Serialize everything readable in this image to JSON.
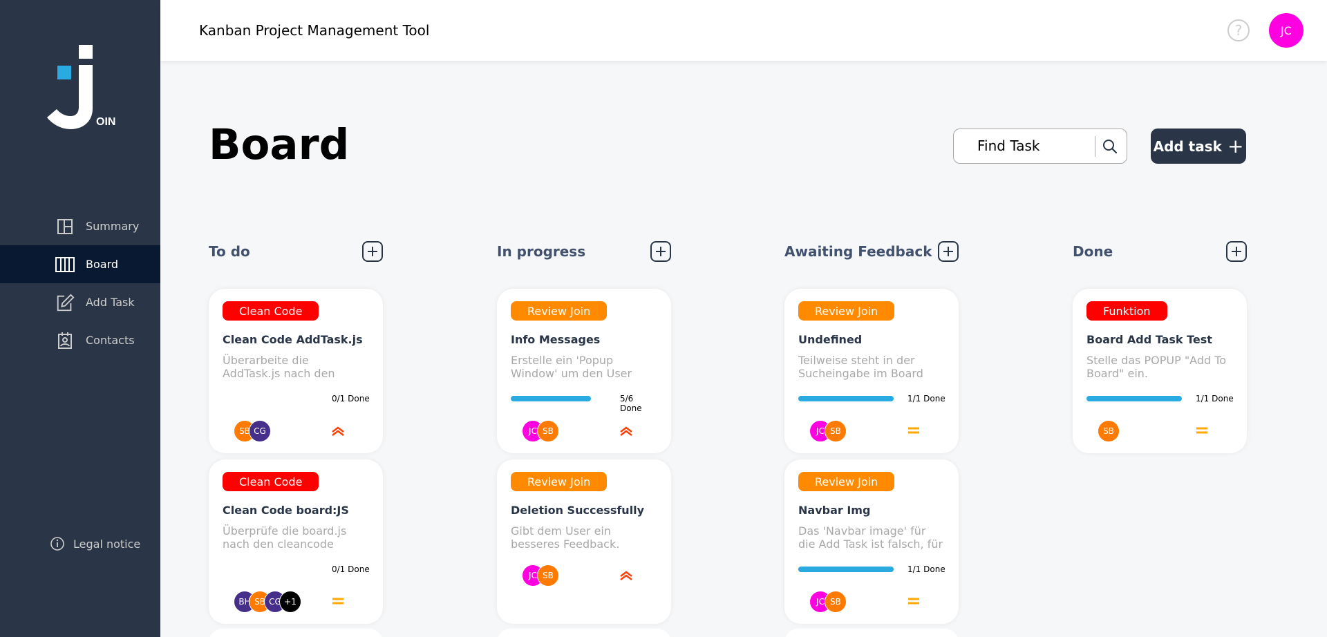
{
  "app": {
    "header_title": "Kanban Project Management Tool",
    "help_label": "?",
    "user_initials": "JC",
    "user_color": "#ff00e0"
  },
  "sidebar": {
    "logo_text": "OIN",
    "items": [
      {
        "label": "Summary",
        "icon": "summary-icon",
        "active": false
      },
      {
        "label": "Board",
        "icon": "board-icon",
        "active": true
      },
      {
        "label": "Add Task",
        "icon": "add-task-icon",
        "active": false
      },
      {
        "label": "Contacts",
        "icon": "contacts-icon",
        "active": false
      }
    ],
    "legal_label": "Legal notice"
  },
  "board": {
    "title": "Board",
    "search_placeholder": "Find Task",
    "add_task_label": "Add task",
    "add_task_icon": "+",
    "columns": [
      {
        "title": "To do"
      },
      {
        "title": "In progress"
      },
      {
        "title": "Awaiting Feedback"
      },
      {
        "title": "Done"
      }
    ]
  },
  "colors": {
    "clean_code": "#ff0000",
    "review_join": "#ff8a00",
    "funktion": "#ff0000",
    "progress": "#29abe2",
    "urgent": "#ff3d00",
    "medium": "#ffa800"
  },
  "cards": {
    "todo_1": {
      "tag": "Clean Code",
      "title": "Clean Code AddTask.js",
      "desc": "Überarbeite die AddTask.js nach den Clean Code",
      "progress_text": "0/1 Done",
      "progress": 0,
      "avatars": [
        {
          "initials": "SB",
          "color": "#ff7a00"
        },
        {
          "initials": "CG",
          "color": "#462f8a"
        }
      ],
      "priority": "urgent"
    },
    "todo_2": {
      "tag": "Clean Code",
      "title": "Clean Code board:JS",
      "desc": "Überprüfe die board.js nach den cleancode",
      "progress_text": "0/1 Done",
      "progress": 0,
      "avatars": [
        {
          "initials": "BH",
          "color": "#462f8a"
        },
        {
          "initials": "SB",
          "color": "#ff7a00"
        },
        {
          "initials": "CG",
          "color": "#462f8a"
        },
        {
          "initials": "+1",
          "color": "#000000"
        }
      ],
      "priority": "medium"
    },
    "prog_1": {
      "tag": "Review Join",
      "title": "Info Messages",
      "desc": "Erstelle ein 'Popup Window' um den User",
      "progress_text": "5/6 Done",
      "progress": 0.833,
      "avatars": [
        {
          "initials": "JC",
          "color": "#ff00e0"
        },
        {
          "initials": "SB",
          "color": "#ff7a00"
        }
      ],
      "priority": "urgent"
    },
    "prog_2": {
      "tag": "Review Join",
      "title": "Deletion Successfully",
      "desc": "Gibt dem User ein besseres Feedback.",
      "avatars": [
        {
          "initials": "JC",
          "color": "#ff00e0"
        },
        {
          "initials": "SB",
          "color": "#ff7a00"
        }
      ],
      "priority": "urgent"
    },
    "await_1": {
      "tag": "Review Join",
      "title": "Undefined",
      "desc": "Teilweise steht in der Sucheingabe im Board",
      "progress_text": "1/1 Done",
      "progress": 1,
      "avatars": [
        {
          "initials": "JC",
          "color": "#ff00e0"
        },
        {
          "initials": "SB",
          "color": "#ff7a00"
        }
      ],
      "priority": "medium"
    },
    "await_2": {
      "tag": "Review Join",
      "title": "Navbar Img",
      "desc": "Das 'Navbar image' für die Add Task ist falsch, für die",
      "progress_text": "1/1 Done",
      "progress": 1,
      "avatars": [
        {
          "initials": "JC",
          "color": "#ff00e0"
        },
        {
          "initials": "SB",
          "color": "#ff7a00"
        }
      ],
      "priority": "medium"
    },
    "done_1": {
      "tag": "Funktion",
      "title": "Board Add Task Test",
      "desc": "Stelle das POPUP \"Add To Board\" ein.",
      "progress_text": "1/1 Done",
      "progress": 1,
      "avatars": [
        {
          "initials": "SB",
          "color": "#ff7a00"
        }
      ],
      "priority": "medium"
    }
  }
}
